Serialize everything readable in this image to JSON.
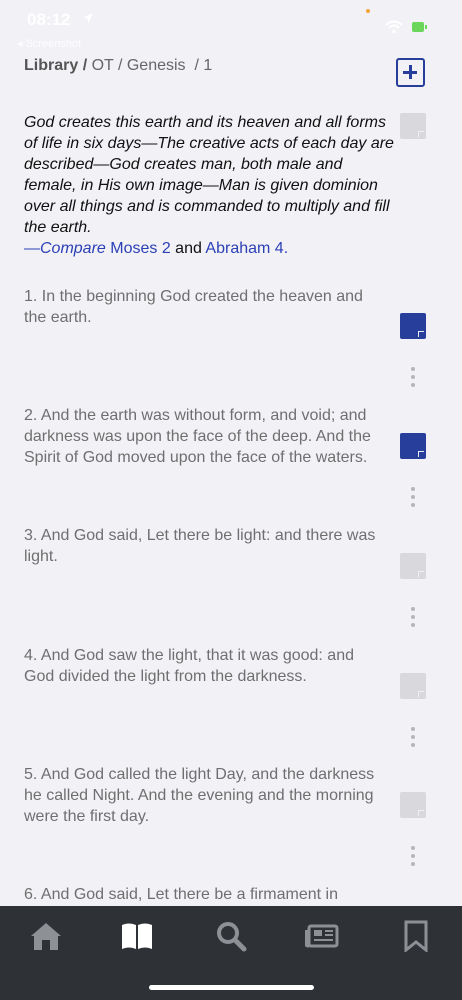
{
  "status": {
    "time": "08:12",
    "back_app": "◂ Screenshot",
    "icons": [
      "location-arrow-icon",
      "wifi-icon",
      "battery-icon"
    ]
  },
  "breadcrumb": {
    "library": "Library",
    "separator": " / ",
    "path": "OT / Genesis",
    "chapter": "/ 1"
  },
  "summary": {
    "text": "God creates this earth and its heaven and all forms of life in six days—The creative acts of each day are described—God creates man, both male and female, in His own image—Man is given dominion over all things and is commanded to multiply and fill the earth.",
    "compare_prefix": "—Compare ",
    "link1": "Moses 2",
    "and": " and ",
    "link2": "Abraham 4."
  },
  "verses": [
    {
      "text": "1. In the beginning God created the heaven and the earth.",
      "note": "filled"
    },
    {
      "text": "2. And the earth was without form, and void; and darkness was upon the face of the deep. And the Spirit of God moved upon the face of the waters.",
      "note": "filled"
    },
    {
      "text": "3. And God said, Let there be light: and there was light.",
      "note": "empty"
    },
    {
      "text": "4. And God saw the light, that it was good: and God divided the light from the darkness.",
      "note": "empty"
    },
    {
      "text": "5. And God called the light Day, and the darkness he called Night. And the evening and the morning were the first day.",
      "note": "empty"
    },
    {
      "text": "6. And God said, Let there be a firmament in",
      "note": "none"
    }
  ],
  "tabs": [
    "home-icon",
    "book-icon",
    "search-icon",
    "news-icon",
    "bookmark-icon"
  ],
  "colors": {
    "accent": "#283e9b",
    "link": "#2c40b6",
    "tabbar": "#2e3237",
    "background": "#f2f1f6"
  }
}
